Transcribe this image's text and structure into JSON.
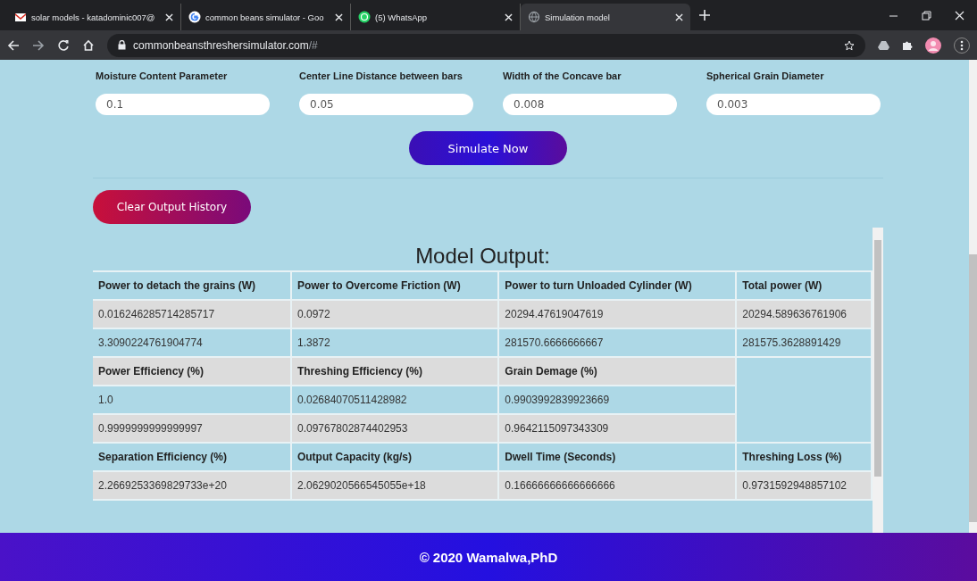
{
  "browser": {
    "tabs": [
      {
        "title": "solar models - katadominic007@",
        "kind": "mail",
        "selected": false
      },
      {
        "title": "common beans simulator - Goo",
        "kind": "google",
        "selected": false
      },
      {
        "title": "(5) WhatsApp",
        "kind": "whatsapp",
        "selected": false
      },
      {
        "title": "Simulation model",
        "kind": "globe",
        "selected": true
      }
    ],
    "url": "commonbeansthreshersimulator.com",
    "url_suffix": "/#"
  },
  "inputs": [
    {
      "label": "Moisture Content Parameter",
      "value": "0.1"
    },
    {
      "label": "Center Line Distance between bars",
      "value": "0.05"
    },
    {
      "label": "Width of the Concave bar",
      "value": "0.008"
    },
    {
      "label": "Spherical Grain Diameter",
      "value": "0.003"
    }
  ],
  "simulate_button": "Simulate Now",
  "clear_button": "Clear Output History",
  "output_title": "Model Output:",
  "table": {
    "sections": [
      {
        "columns": [
          "Power to detach the grains (W)",
          "Power to Overcome Friction (W)",
          "Power to turn Unloaded Cylinder (W)",
          "Total power (W)"
        ],
        "rows": [
          [
            "0.016246285714285717",
            "0.0972",
            "20294.47619047619",
            "20294.589636761906"
          ],
          [
            "3.3090224761904774",
            "1.3872",
            "281570.6666666667",
            "281575.3628891429"
          ]
        ]
      },
      {
        "columns": [
          "Power Efficiency (%)",
          "Threshing Efficiency (%)",
          "Grain Demage (%)"
        ],
        "rows": [
          [
            "1.0",
            "0.02684070511428982",
            "0.9903992839923669"
          ],
          [
            "0.9999999999999997",
            "0.09767802874402953",
            "0.9642115097343309"
          ]
        ]
      },
      {
        "columns": [
          "Separation Efficiency (%)",
          "Output Capacity (kg/s)",
          "Dwell Time (Seconds)",
          "Threshing Loss (%)"
        ],
        "rows": [
          [
            "2.2669253369829733e+20",
            "2.0629020566545055e+18",
            "0.16666666666666666",
            "0.9731592948857102"
          ]
        ]
      }
    ]
  },
  "footer": "© 2020 Wamalwa,PhD"
}
